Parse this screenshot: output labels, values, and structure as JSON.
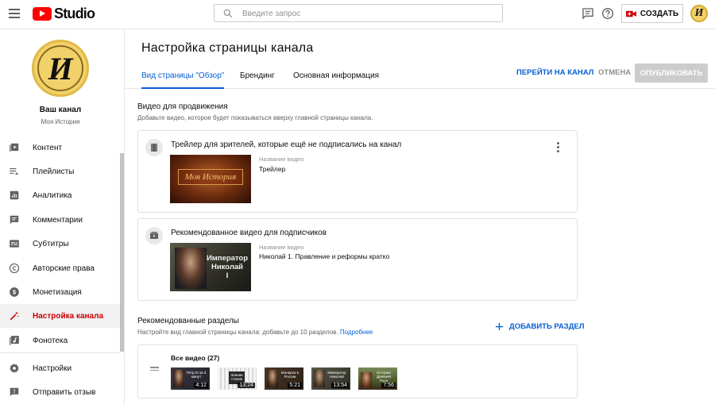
{
  "app": {
    "logo_text": "Studio",
    "search_placeholder": "Введите запрос",
    "create_label": "СОЗДАТЬ",
    "avatar_letter": "И"
  },
  "sidebar": {
    "channel_name": "Ваш канал",
    "channel_subtitle": "Моя История",
    "avatar_letter": "И",
    "items": [
      {
        "label": "Контент",
        "icon": "content-icon"
      },
      {
        "label": "Плейлисты",
        "icon": "playlists-icon"
      },
      {
        "label": "Аналитика",
        "icon": "analytics-icon"
      },
      {
        "label": "Комментарии",
        "icon": "comments-icon"
      },
      {
        "label": "Субтитры",
        "icon": "subtitles-icon"
      },
      {
        "label": "Авторские права",
        "icon": "copyright-icon"
      },
      {
        "label": "Монетизация",
        "icon": "monetization-icon"
      },
      {
        "label": "Настройка канала",
        "icon": "customization-icon",
        "active": true
      },
      {
        "label": "Фонотека",
        "icon": "audio-library-icon"
      }
    ],
    "bottom_items": [
      {
        "label": "Настройки",
        "icon": "settings-icon"
      },
      {
        "label": "Отправить отзыв",
        "icon": "feedback-icon"
      }
    ]
  },
  "main": {
    "title": "Настройка страницы канала",
    "tabs": [
      {
        "label": "Вид страницы \"Обзор\"",
        "active": true
      },
      {
        "label": "Брендинг"
      },
      {
        "label": "Основная информация"
      }
    ],
    "go_to_channel": "ПЕРЕЙТИ НА КАНАЛ",
    "cancel": "ОТМЕНА",
    "publish": "ОПУБЛИКОВАТЬ",
    "featured": {
      "title": "Видео для продвижения",
      "description": "Добавьте видео, которое будет показываться вверху главной страницы канала.",
      "cards": [
        {
          "title": "Трейлер для зрителей, которые ещё не подписались на канал",
          "field_label": "Название видео",
          "video_title": "Трейлер",
          "thumb_text": "Моя История",
          "icon": "film-icon"
        },
        {
          "title": "Рекомендованное видео для подписчиков",
          "field_label": "Название видео",
          "video_title": "Николай 1. Правление и реформы кратко",
          "thumb_text_1": "Император",
          "thumb_text_2": "Николай",
          "thumb_text_3": "I",
          "icon": "featured-video-icon"
        }
      ]
    },
    "sections": {
      "title": "Рекомендованные разделы",
      "description": "Настройте вид главной страницы канала: добавьте до 10 разделов.",
      "more_link": "Подробнее",
      "add_label": "ДОБАВИТЬ РАЗДЕЛ",
      "all_videos": {
        "title": "Все видео (27)",
        "videos": [
          {
            "duration": "4:12",
            "caption": "Петр III за 3 минут"
          },
          {
            "duration": "13:24",
            "caption": "Знание стихов"
          },
          {
            "duration": "5:21",
            "caption": "Монархи в России"
          },
          {
            "duration": "13:54",
            "caption": "Император Николай"
          },
          {
            "duration": "7:56",
            "caption": "История Древней Руси"
          }
        ]
      }
    }
  },
  "colors": {
    "accent": "#065fd4",
    "active_red": "#cc0000",
    "brand_red": "#ff0000"
  }
}
